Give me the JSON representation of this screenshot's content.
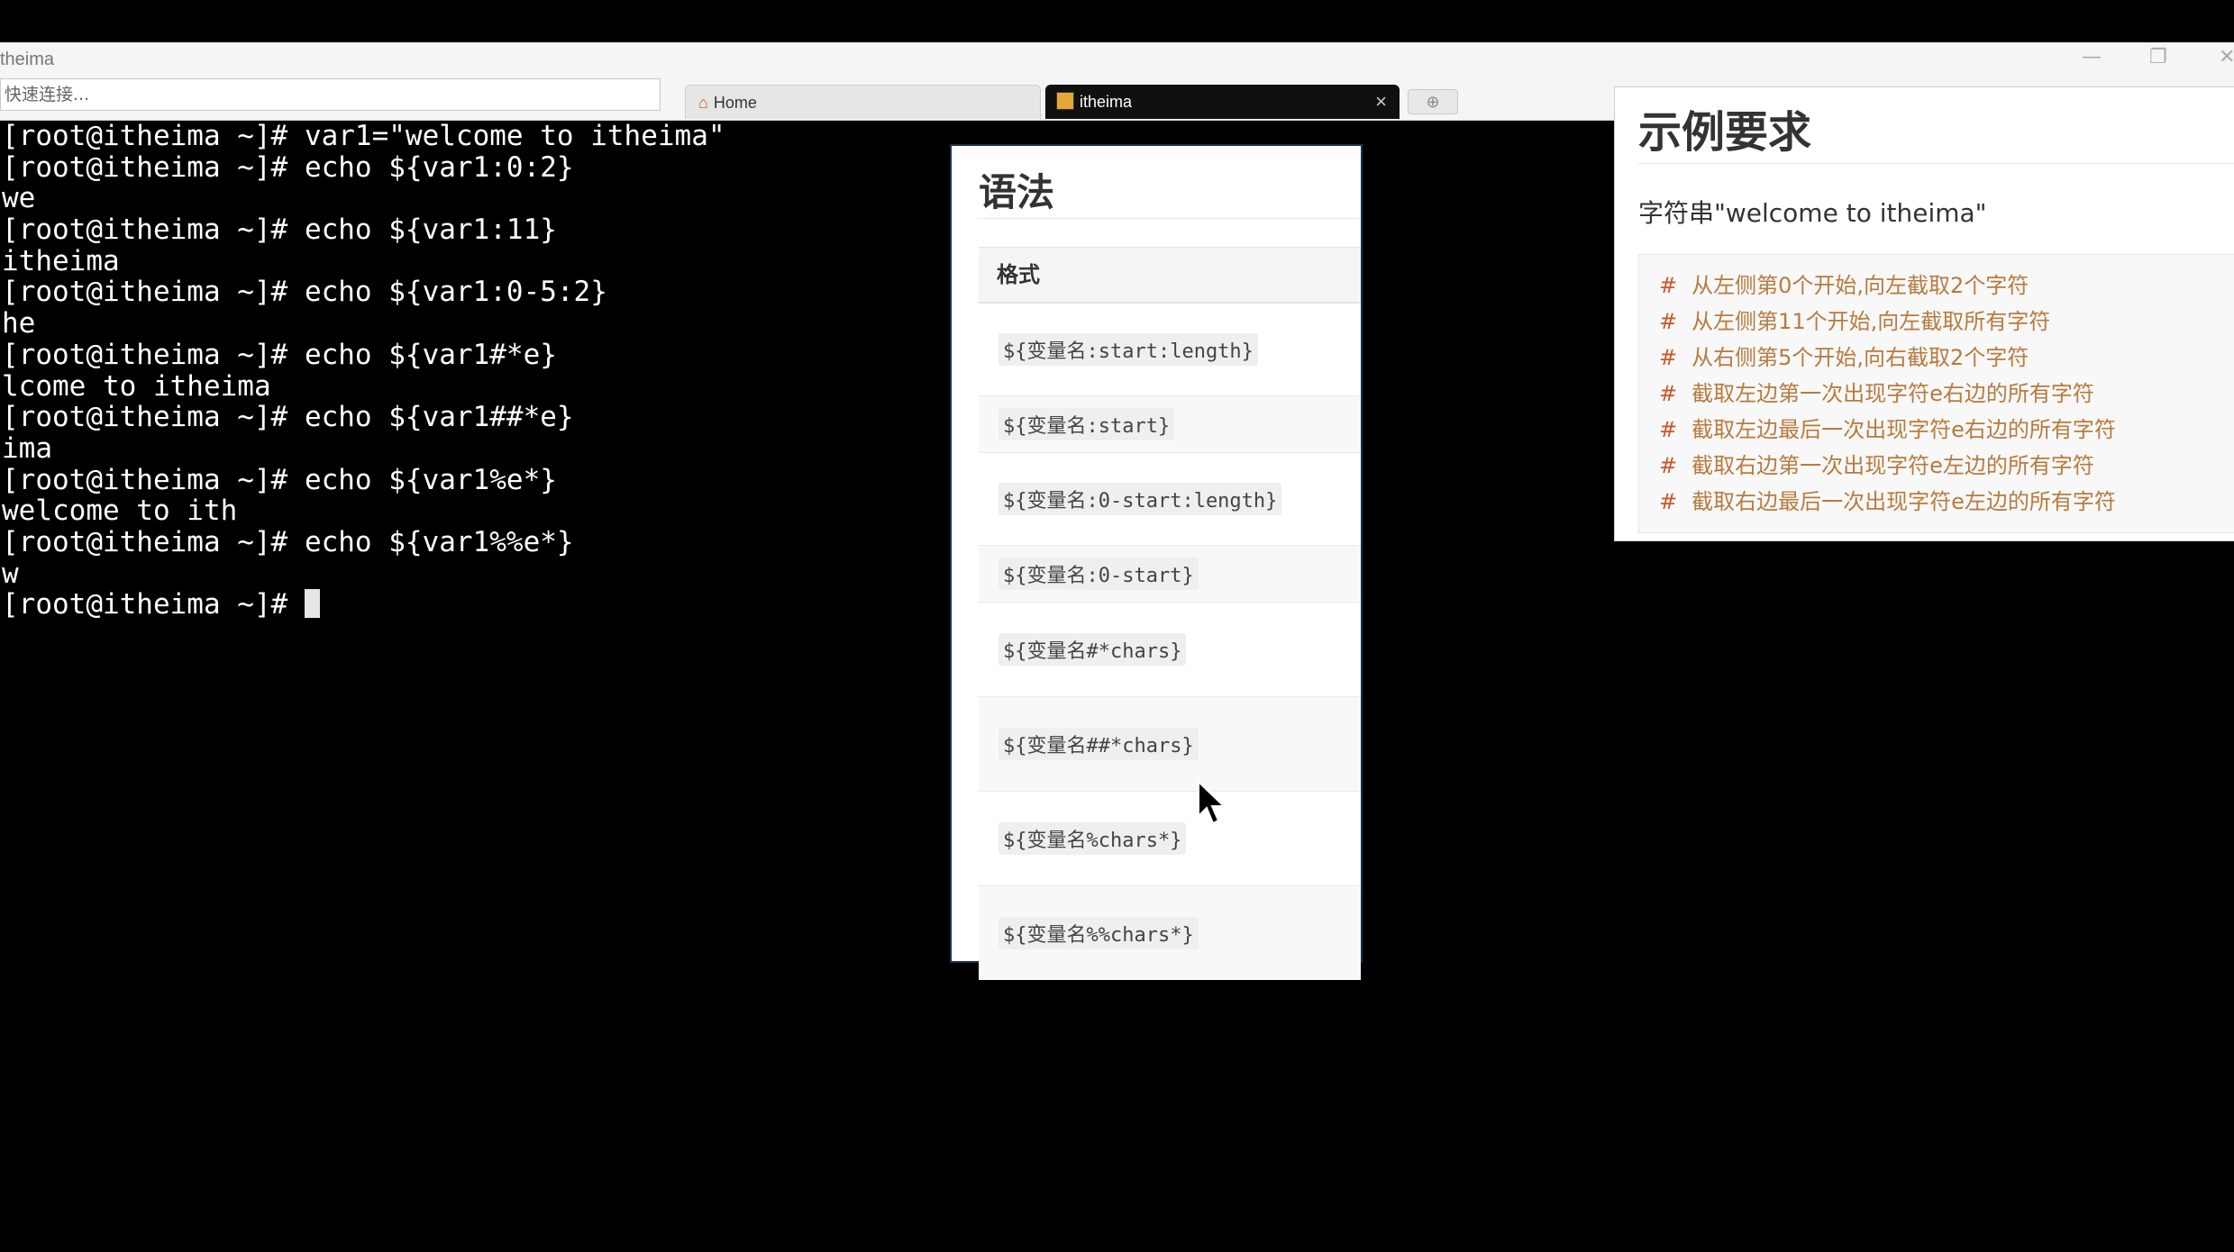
{
  "window": {
    "title": "theima",
    "minimize": "—",
    "restore": "❐",
    "close": "✕",
    "quick_connect_placeholder": "快速连接..."
  },
  "tabs": [
    {
      "label": "Home"
    },
    {
      "label": "itheima",
      "close": "×"
    }
  ],
  "new_tab_label": "⊕",
  "terminal": {
    "lines": [
      "[root@itheima ~]# var1=\"welcome to itheima\"",
      "[root@itheima ~]# echo ${var1:0:2}",
      "we",
      "[root@itheima ~]# echo ${var1:11}",
      "itheima",
      "[root@itheima ~]# echo ${var1:0-5:2}",
      "he",
      "[root@itheima ~]# echo ${var1#*e}",
      "lcome to itheima",
      "[root@itheima ~]# echo ${var1##*e}",
      "ima",
      "[root@itheima ~]# echo ${var1%e*}",
      "welcome to ith",
      "[root@itheima ~]# echo ${var1%%e*}",
      "w"
    ],
    "prompt": "[root@itheima ~]# "
  },
  "syntax": {
    "title": "语法",
    "header": "格式",
    "rows": [
      "${变量名:start:length}",
      "${变量名:start}",
      "${变量名:0-start:length}",
      "${变量名:0-start}",
      "${变量名#*chars}",
      "${变量名##*chars}",
      "${变量名%chars*}",
      "${变量名%%chars*}"
    ]
  },
  "example": {
    "title": "示例要求",
    "desc": "字符串\"welcome to itheima\"",
    "hash": "#",
    "lines": [
      "从左侧第0个开始,向左截取2个字符",
      "从左侧第11个开始,向左截取所有字符",
      "从右侧第5个开始,向右截取2个字符",
      "截取左边第一次出现字符e右边的所有字符",
      "截取左边最后一次出现字符e右边的所有字符",
      "截取右边第一次出现字符e左边的所有字符",
      "截取右边最后一次出现字符e左边的所有字符"
    ]
  }
}
